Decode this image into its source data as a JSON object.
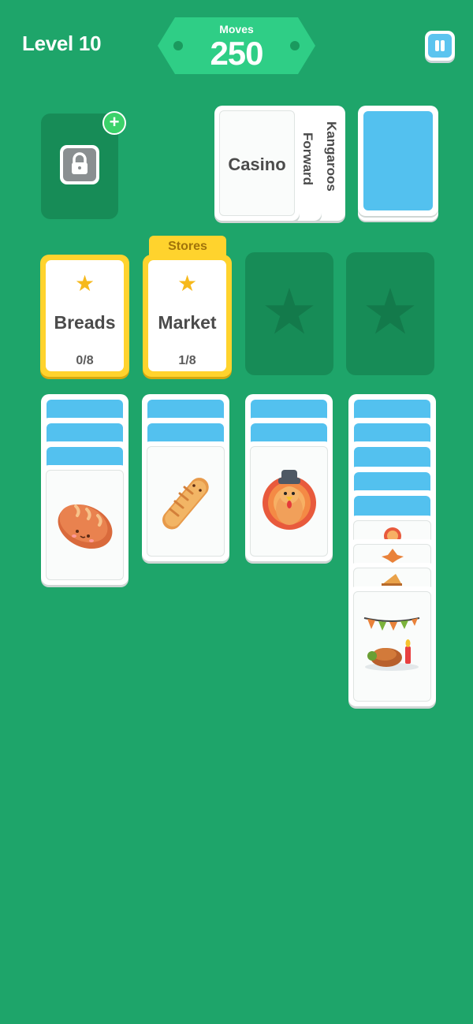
{
  "header": {
    "level_text": "Level 10",
    "moves_label": "Moves",
    "moves_value": "250",
    "pause_icon": "pause-icon"
  },
  "stock": {
    "locked_slot_icon": "lock-icon",
    "add_icon": "plus-icon",
    "waste_cards": [
      "Casino",
      "Forward",
      "Kangaroos"
    ],
    "draw_pile_icon": "card-back"
  },
  "foundations": [
    {
      "title": "Breads",
      "count": "0/8",
      "star_icon": "star-icon"
    },
    {
      "title": "Market",
      "count": "1/8",
      "star_icon": "star-icon",
      "tag": "Stores"
    },
    {
      "empty": true,
      "icon": "star-icon"
    },
    {
      "empty": true,
      "icon": "star-icon"
    }
  ],
  "tableau": [
    {
      "face_down": 3,
      "face_up": [
        "bread-loaf"
      ]
    },
    {
      "face_down": 2,
      "face_up": [
        "croissant"
      ]
    },
    {
      "face_down": 2,
      "face_up": [
        "turkey"
      ]
    },
    {
      "face_down": 5,
      "face_up": [
        "turkey-small",
        "autumn-leaves",
        "pie-slice",
        "thanksgiving-dinner"
      ]
    }
  ],
  "colors": {
    "background": "#1ea56a",
    "slot": "#178c57",
    "card_back": "#53c1ef",
    "foundation_gold": "#ffd32d",
    "star": "#f6b91c"
  }
}
